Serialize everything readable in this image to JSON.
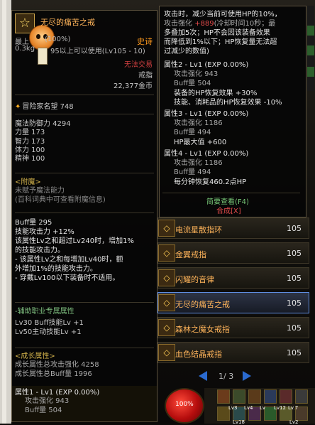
{
  "item": {
    "name": "无尽的痛苦之戒",
    "rarity": "史诗",
    "level_text": "最上",
    "durability_text": "(100%)",
    "weight_text": "0.3kg",
    "requirement_text": "95以上可以使用(Lv105 - 10)",
    "trade_text": "无法交易",
    "slot_text": "戒指",
    "price_text": "22,377金币",
    "fame_text": "冒险家名望 748",
    "magic_def": "魔法防御力 4294",
    "stats": [
      "力量 173",
      "智力 173",
      "体力 100",
      "精神 100"
    ],
    "enchant_head": "<附魔>",
    "enchant_lines": [
      "未赋予魔法能力",
      "(百科词典中可查看附魔信息)"
    ],
    "desc_lines": [
      "Buff量 295",
      "技能攻击力 +12%",
      "该属性Lv之和超过Lv240时，增加1%",
      "的技能攻击力。",
      "- 该属性Lv之和每增加Lv40时，额",
      "外增加1%的技能攻击力。",
      "- 穿戴Lv100以下装备时不适用。"
    ],
    "sub_head": "-辅助职业专属属性",
    "sub_lines": [
      "Lv30 Buff技能Lv +1",
      "Lv50主动技能Lv +1"
    ],
    "growth_head": "<成长属性>",
    "growth_lines": [
      "成长属性总攻击强化 4258",
      "成长属性总Buff量 1996"
    ],
    "attr1_head": "属性1 - Lv1 (EXP 0.00%)",
    "attr1_lines": [
      "攻击强化 943",
      "Buff量 504"
    ]
  },
  "tooltip2": {
    "line_a": "攻击时，减少当前可使用HP的10%，",
    "line_b_pre": "攻击强化",
    "line_b_red": "+889",
    "line_b_post": "(冷却时间10秒；最",
    "line_c": "多叠加5次；HP不会因该装备效果",
    "line_d": "而降低到1%以下；HP恢复量无法超",
    "line_e": "过减少的数值)",
    "attr2_head": "属性2 - Lv1 (EXP 0.00%)",
    "attr2_lines": [
      "攻击强化 943",
      "Buff量 504"
    ],
    "attr2_extra": [
      "装备的HP恢复效果 +30%",
      "技能、消耗品的HP恢复效果 -10%"
    ],
    "attr3_head": "属性3 - Lv1 (EXP 0.00%)",
    "attr3_lines": [
      "攻击强化 1186",
      "Buff量 494"
    ],
    "attr3_extra": [
      "HP最大值 +600"
    ],
    "attr4_head": "属性4 - Lv1 (EXP 0.00%)",
    "attr4_lines": [
      "攻击强化 1186",
      "Buff量 494"
    ],
    "attr4_extra": [
      "每分钟恢复460.2点HP"
    ],
    "brief_link": "简要查看(F4)",
    "synth_link": "合成[X]"
  },
  "list_items": [
    {
      "name": "电流星散指环",
      "level": "105"
    },
    {
      "name": "金翼戒指",
      "level": "105"
    },
    {
      "name": "闪耀的音律",
      "level": "105"
    },
    {
      "name": "无尽的痛苦之戒",
      "level": "105"
    },
    {
      "name": "森林之魔女戒指",
      "level": "105"
    },
    {
      "name": "血色结晶戒指",
      "level": "105"
    }
  ],
  "pager": {
    "text": "1/ 3"
  },
  "hp_orb": {
    "text": "100%"
  },
  "skill_labels": [
    "Lv3",
    "Lv4",
    "Lv",
    "Lv12",
    "Lv.7",
    "Lv18",
    "Lv2"
  ],
  "colors": {
    "rarity_epic": "#ff9a1e",
    "name": "#ffb45a",
    "red": "#e34b4b",
    "link_green": "#78c878",
    "selected": "#5f8de0"
  }
}
